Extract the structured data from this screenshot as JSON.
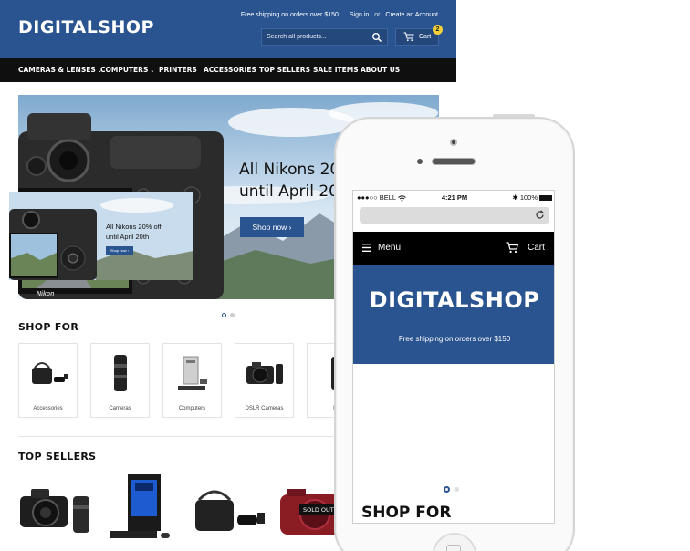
{
  "desktop": {
    "logo": "DIGITALSHOP",
    "toplinks": {
      "shipping": "Free shipping on orders over $150",
      "sign_in": "Sign in",
      "or": "or",
      "create_account": "Create an Account"
    },
    "search": {
      "placeholder": "Search all products..."
    },
    "cart": {
      "label": "Cart",
      "count": "2"
    },
    "nav": [
      {
        "label": "CAMERAS & LENSES",
        "dropdown": true
      },
      {
        "label": "COMPUTERS",
        "dropdown": true
      },
      {
        "label": "PRINTERS"
      },
      {
        "label": "ACCESSORIES"
      },
      {
        "label": "TOP SELLERS"
      },
      {
        "label": "SALE ITEMS"
      },
      {
        "label": "ABOUT US"
      }
    ],
    "hero": {
      "line1": "All Nikons 20",
      "line2": "until April 20",
      "button": "Shop now ›",
      "camera_brand": "Nikon"
    },
    "shop_for_title": "SHOP FOR",
    "categories": [
      {
        "label": "Accessories"
      },
      {
        "label": "Cameras"
      },
      {
        "label": "Computers"
      },
      {
        "label": "DSLR Cameras"
      },
      {
        "label": "Le"
      }
    ],
    "top_sellers_title": "TOP SELLERS",
    "sold_out": "SOLD OUT"
  },
  "mobile": {
    "status": {
      "carrier": "●●●○○ BELL",
      "time": "4:21 PM",
      "battery": "100%"
    },
    "nav": {
      "menu": "Menu",
      "cart": "Cart"
    },
    "logo": "DIGITALSHOP",
    "shipping": "Free shipping on orders over $150",
    "hero": {
      "line1": "All Nikons 20% off",
      "line2": "until April 20th",
      "button": "Shop now ›"
    },
    "shop_for_title": "SHOP FOR"
  },
  "colors": {
    "brand_blue": "#2a5490",
    "nav_black": "#0f0f0f",
    "badge_yellow": "#f4d03a"
  },
  "icons": [
    "search-icon",
    "cart-icon",
    "chevron-down-icon",
    "hamburger-icon",
    "reload-icon",
    "wifi-icon",
    "battery-icon",
    "chevron-right-icon"
  ]
}
